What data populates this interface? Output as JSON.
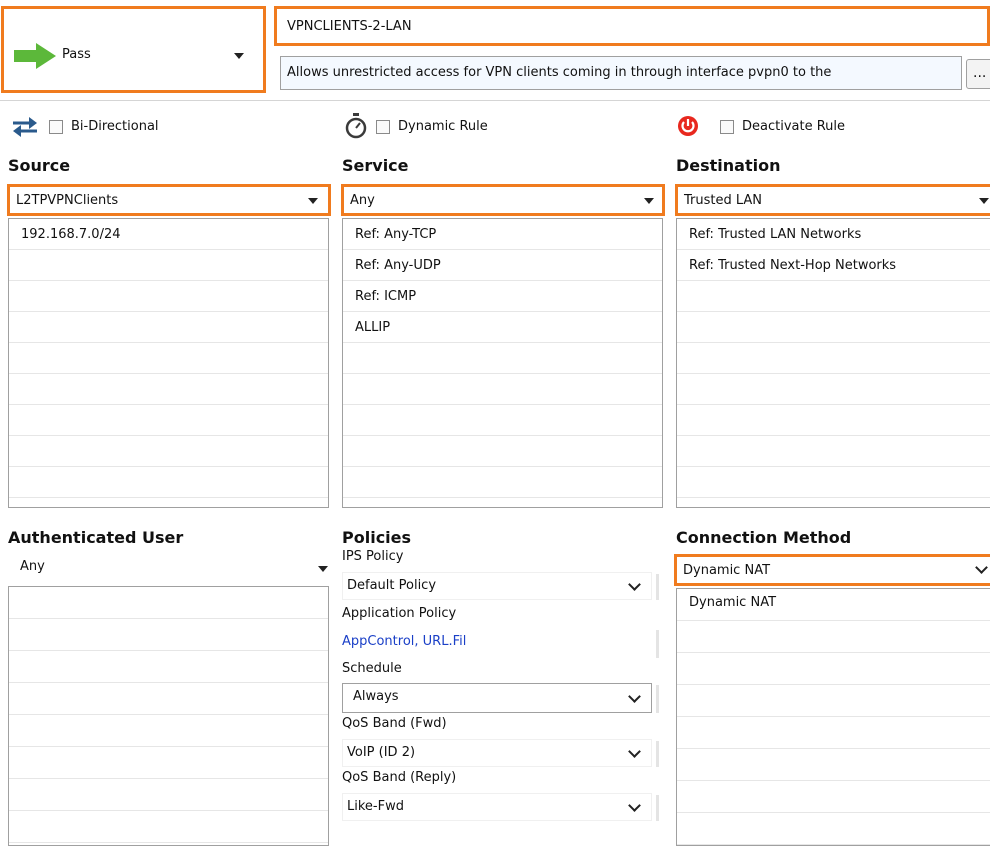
{
  "header": {
    "action": "Pass",
    "rule_name": "VPNCLIENTS-2-LAN",
    "description": "Allows unrestricted access for VPN clients coming in through interface pvpn0  to the",
    "more_button": "..."
  },
  "options": {
    "bidirectional": "Bi-Directional",
    "dynamic_rule": "Dynamic Rule",
    "deactivate_rule": "Deactivate Rule"
  },
  "source": {
    "title": "Source",
    "selected": "L2TPVPNClients",
    "items": [
      "192.168.7.0/24"
    ]
  },
  "service": {
    "title": "Service",
    "selected": "Any",
    "items": [
      "Ref: Any-TCP",
      "Ref: Any-UDP",
      "Ref: ICMP",
      "ALLIP"
    ]
  },
  "destination": {
    "title": "Destination",
    "selected": "Trusted  LAN",
    "items": [
      "Ref: Trusted LAN Networks",
      "Ref: Trusted Next-Hop Networks"
    ]
  },
  "auth_user": {
    "title": "Authenticated User",
    "selected": "Any"
  },
  "policies": {
    "title": "Policies",
    "ips_label": "IPS Policy",
    "ips_value": "Default Policy",
    "app_label": "Application Policy",
    "app_value": "AppControl, URL.Fil",
    "schedule_label": "Schedule",
    "schedule_value": "Always",
    "qos_fwd_label": "QoS Band (Fwd)",
    "qos_fwd_value": "VoIP (ID 2)",
    "qos_reply_label": "QoS Band (Reply)",
    "qos_reply_value": "Like-Fwd"
  },
  "connection": {
    "title": "Connection Method",
    "selected": "Dynamic NAT",
    "items": [
      "Dynamic NAT"
    ]
  },
  "colors": {
    "highlight": "#f07b1e",
    "pass_arrow": "#5cb83a",
    "link": "#1a3fc7",
    "power": "#e8281e"
  }
}
